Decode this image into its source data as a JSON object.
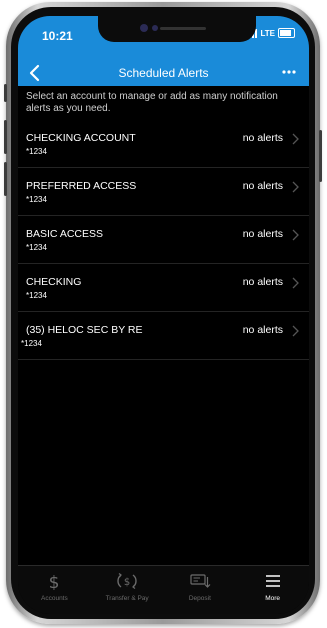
{
  "status_bar": {
    "time": "10:21",
    "network": "LTE"
  },
  "nav": {
    "title": "Scheduled Alerts"
  },
  "intro_text": "Select an account to manage or add as many notification alerts as you need.",
  "accounts": [
    {
      "name": "CHECKING ACCOUNT",
      "number": "*1234",
      "status": "no alerts"
    },
    {
      "name": "PREFERRED ACCESS",
      "number": "*1234",
      "status": "no alerts"
    },
    {
      "name": "BASIC ACCESS",
      "number": "*1234",
      "status": "no alerts"
    },
    {
      "name": "CHECKING",
      "number": "*1234",
      "status": "no alerts"
    },
    {
      "name": "(35)  HELOC SEC BY RE",
      "number": "*1234",
      "status": "no alerts"
    }
  ],
  "tab_bar": [
    {
      "label": "Accounts",
      "icon": "dollar-icon"
    },
    {
      "label": "Transfer & Pay",
      "icon": "transfer-pay-icon"
    },
    {
      "label": "Deposit",
      "icon": "deposit-check-icon"
    },
    {
      "label": "More",
      "icon": "menu-icon",
      "active": true
    }
  ],
  "colors": {
    "header": "#1a8bd9",
    "background": "#000000",
    "text": "#ffffff",
    "muted": "#6c6c6c"
  }
}
